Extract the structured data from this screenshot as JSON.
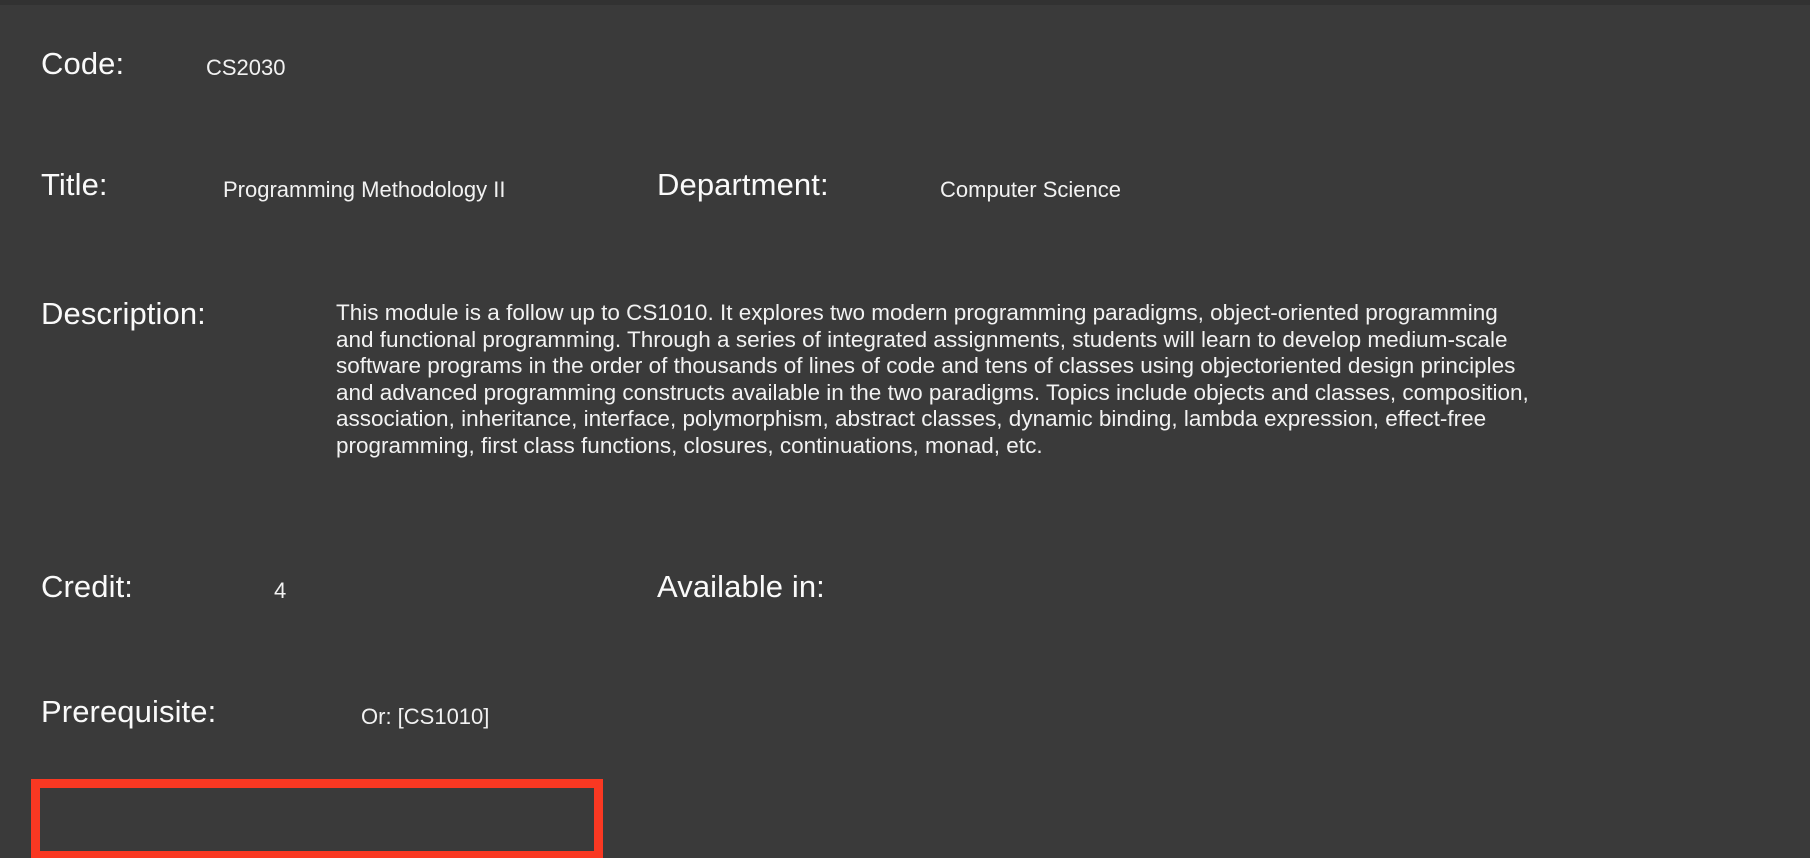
{
  "theme": {
    "background": "#3a3a3a",
    "text": "#fafafa",
    "value_text": "#f2f2f2",
    "highlight_border": "#f93822",
    "top_strip": "#323232"
  },
  "module": {
    "code": {
      "label": "Code:",
      "value": "CS2030"
    },
    "title": {
      "label": "Title:",
      "value": "Programming Methodology II"
    },
    "department": {
      "label": "Department:",
      "value": "Computer Science"
    },
    "description": {
      "label": "Description:",
      "value": "This module is a follow up to CS1010. It explores two modern programming paradigms, object-oriented programming and functional programming. Through a series of integrated assignments, students will learn to develop medium-scale software programs in the order of thousands of lines of code and tens of classes using objectoriented design principles and advanced programming constructs available in the two paradigms. Topics include objects and classes, composition, association, inheritance, interface, polymorphism, abstract classes, dynamic binding, lambda expression, effect-free programming, first class functions, closures, continuations, monad, etc."
    },
    "credit": {
      "label": "Credit:",
      "value": "4"
    },
    "available_in": {
      "label": "Available in:",
      "value": ""
    },
    "prerequisite": {
      "label": "Prerequisite:",
      "value": "Or: [CS1010]"
    }
  }
}
